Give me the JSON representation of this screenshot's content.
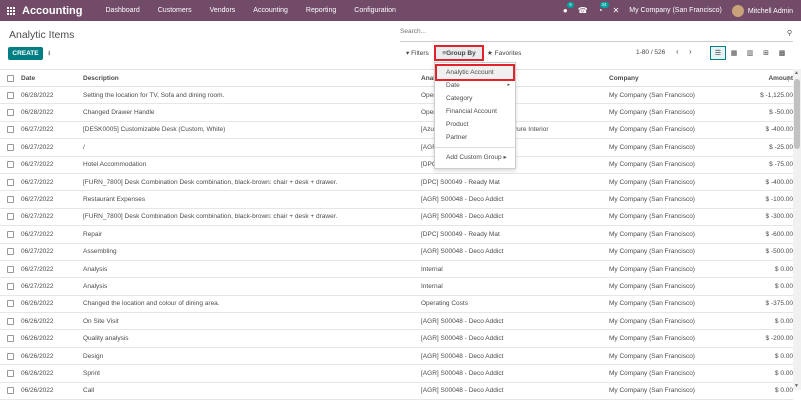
{
  "navbar": {
    "brand": "Accounting",
    "menu": [
      "Dashboard",
      "Customers",
      "Vendors",
      "Accounting",
      "Reporting",
      "Configuration"
    ],
    "messages_badge": "5",
    "activities_badge": "34",
    "company": "My Company (San Francisco)",
    "user": "Mitchell Admin"
  },
  "page": {
    "title": "Analytic Items",
    "search_placeholder": "Search...",
    "create_label": "CREATE",
    "filters_label": "Filters",
    "groupby_label": "Group By",
    "favorites_label": "Favorites",
    "pager": "1-80 / 526"
  },
  "dropdown": {
    "items": [
      {
        "label": "Analytic Account",
        "caret": ""
      },
      {
        "label": "Date",
        "caret": "▸"
      },
      {
        "label": "Category",
        "caret": ""
      },
      {
        "label": "Financial Account",
        "caret": ""
      },
      {
        "label": "Product",
        "caret": ""
      },
      {
        "label": "Partner",
        "caret": ""
      }
    ],
    "custom_group": "Add Custom Group",
    "custom_caret": "▸"
  },
  "table": {
    "headers": {
      "date": "Date",
      "description": "Description",
      "analytic": "Anal",
      "company": "Company",
      "amount": "Amount"
    },
    "rows": [
      {
        "date": "06/28/2022",
        "description": "Setting the location for TV, Sofa and dining room.",
        "analytic": "Oper",
        "company": "My Company (San Francisco)",
        "amount": "$ -1,125.00"
      },
      {
        "date": "06/28/2022",
        "description": "Changed Drawer Handle",
        "analytic": "Oper",
        "company": "My Company (San Francisco)",
        "amount": "$ -50.00"
      },
      {
        "date": "06/27/2022",
        "description": "[DESK0005] Customizable Desk (Custom, White)",
        "analytic": "[Azur                                   C - Azure Interior",
        "company": "My Company (San Francisco)",
        "amount": "$ -400.00"
      },
      {
        "date": "06/27/2022",
        "description": "/",
        "analytic": "[AGR",
        "company": "My Company (San Francisco)",
        "amount": "$ -25.00"
      },
      {
        "date": "06/27/2022",
        "description": "Hotel Accommodation",
        "analytic": "[DPC] S00049 - Ready Mat",
        "company": "My Company (San Francisco)",
        "amount": "$ -75.00"
      },
      {
        "date": "06/27/2022",
        "description": "[FURN_7800] Desk Combination Desk combination, black-brown: chair + desk + drawer.",
        "analytic": "[DPC] S00049 - Ready Mat",
        "company": "My Company (San Francisco)",
        "amount": "$ -400.00"
      },
      {
        "date": "06/27/2022",
        "description": "Restaurant Expenses",
        "analytic": "[AGR] S00048 - Deco Addict",
        "company": "My Company (San Francisco)",
        "amount": "$ -100.00"
      },
      {
        "date": "06/27/2022",
        "description": "[FURN_7800] Desk Combination Desk combination, black-brown: chair + desk + drawer.",
        "analytic": "[AGR] S00048 - Deco Addict",
        "company": "My Company (San Francisco)",
        "amount": "$ -300.00"
      },
      {
        "date": "06/27/2022",
        "description": "Repair",
        "analytic": "[DPC] S00049 - Ready Mat",
        "company": "My Company (San Francisco)",
        "amount": "$ -600.00"
      },
      {
        "date": "06/27/2022",
        "description": "Assembling",
        "analytic": "[AGR] S00048 - Deco Addict",
        "company": "My Company (San Francisco)",
        "amount": "$ -500.00"
      },
      {
        "date": "06/27/2022",
        "description": "Analysis",
        "analytic": "Internal",
        "company": "My Company (San Francisco)",
        "amount": "$ 0.00"
      },
      {
        "date": "06/27/2022",
        "description": "Analysis",
        "analytic": "Internal",
        "company": "My Company (San Francisco)",
        "amount": "$ 0.00"
      },
      {
        "date": "06/26/2022",
        "description": "Changed the location and colour of dining area.",
        "analytic": "Operating Costs",
        "company": "My Company (San Francisco)",
        "amount": "$ -375.00"
      },
      {
        "date": "06/26/2022",
        "description": "On Site Visit",
        "analytic": "[AGR] S00048 - Deco Addict",
        "company": "My Company (San Francisco)",
        "amount": "$ 0.00"
      },
      {
        "date": "06/26/2022",
        "description": "Quality analysis",
        "analytic": "[AGR] S00048 - Deco Addict",
        "company": "My Company (San Francisco)",
        "amount": "$ -200.00"
      },
      {
        "date": "06/26/2022",
        "description": "Design",
        "analytic": "[AGR] S00048 - Deco Addict",
        "company": "My Company (San Francisco)",
        "amount": "$ 0.00"
      },
      {
        "date": "06/26/2022",
        "description": "Sprint",
        "analytic": "[AGR] S00048 - Deco Addict",
        "company": "My Company (San Francisco)",
        "amount": "$ 0.00"
      },
      {
        "date": "06/26/2022",
        "description": "Call",
        "analytic": "[AGR] S00048 - Deco Addict",
        "company": "My Company (San Francisco)",
        "amount": "$ 0.00"
      }
    ]
  }
}
